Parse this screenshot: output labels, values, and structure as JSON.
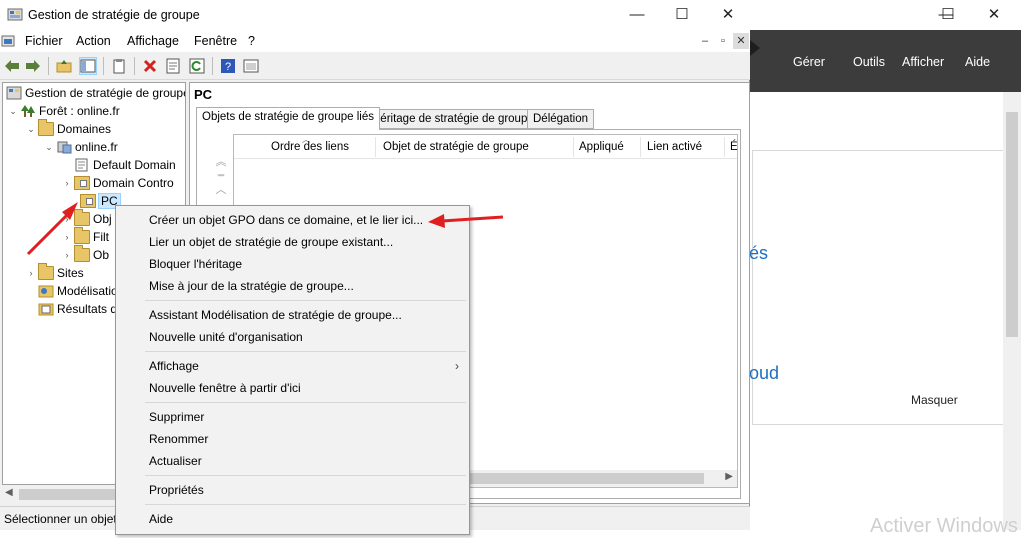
{
  "background_window": {
    "menu": [
      "Gérer",
      "Outils",
      "Afficher",
      "Aide"
    ],
    "partial_text_1": "és",
    "partial_text_2": "oud",
    "hide_label": "Masquer",
    "watermark": "Activer Windows"
  },
  "window": {
    "title": "Gestion de stratégie de groupe",
    "minimize": "—",
    "maximize": "☐",
    "close": "✕"
  },
  "menubar": {
    "items": [
      "Fichier",
      "Action",
      "Affichage",
      "Fenêtre",
      "?"
    ],
    "mdi_buttons": [
      "–",
      "▫",
      "✕"
    ]
  },
  "tree": {
    "nodes": [
      {
        "label": "Gestion de stratégie de groupe"
      },
      {
        "label": "Forêt : online.fr"
      },
      {
        "label": "Domaines"
      },
      {
        "label": "online.fr"
      },
      {
        "label": "Default Domain"
      },
      {
        "label": "Domain Contro"
      },
      {
        "label": "PC"
      },
      {
        "label": "Obj"
      },
      {
        "label": "Filt"
      },
      {
        "label": "Ob"
      },
      {
        "label": "Sites"
      },
      {
        "label": "Modélisation"
      },
      {
        "label": "Résultats de"
      }
    ]
  },
  "status": {
    "text": "Sélectionner un objet"
  },
  "right": {
    "header": "PC",
    "tabs": [
      "Objets de stratégie de groupe liés",
      "Héritage de stratégie de groupe",
      "Délégation"
    ],
    "columns": [
      "Ordre des liens",
      "Objet de stratégie de groupe",
      "Appliqué",
      "Lien activé",
      "É"
    ]
  },
  "context_menu": {
    "items": [
      "Créer un objet GPO dans ce domaine, et le lier ici...",
      "Lier un objet de stratégie de groupe existant...",
      "Bloquer l'héritage",
      "Mise à jour de la stratégie de groupe...",
      "Assistant Modélisation de stratégie de groupe...",
      "Nouvelle unité d'organisation",
      "Affichage",
      "Nouvelle fenêtre à partir d'ici",
      "Supprimer",
      "Renommer",
      "Actualiser",
      "Propriétés",
      "Aide"
    ],
    "submenu_arrow": "›"
  },
  "colors": {
    "selection": "#cce8ff",
    "folder": "#e8c567",
    "annotation_red": "#e02020",
    "dark_bar": "#3c3c3c"
  }
}
